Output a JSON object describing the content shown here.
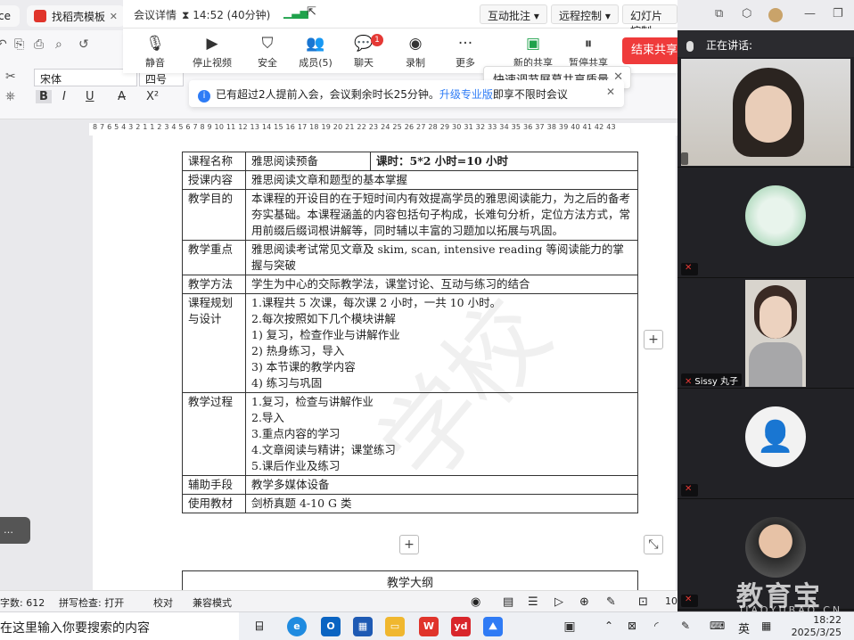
{
  "browser_tabs": [
    {
      "label": "ce"
    },
    {
      "label": "找稻壳模板"
    }
  ],
  "meeting": {
    "details_label": "会议详情",
    "time": "14:52 (40分钟)",
    "annotate_label": "互动批注",
    "remote_label": "远程控制",
    "slideshow_label": "幻灯片控制",
    "toolbar": [
      {
        "label": "静音",
        "icon": "mic-icon"
      },
      {
        "label": "停止视频",
        "icon": "camera-icon"
      },
      {
        "label": "安全",
        "icon": "shield-icon"
      },
      {
        "label": "成员(5)",
        "icon": "members-icon"
      },
      {
        "label": "聊天",
        "icon": "chat-icon",
        "badge": "1"
      },
      {
        "label": "录制",
        "icon": "record-icon"
      },
      {
        "label": "更多",
        "icon": "more-icon"
      },
      {
        "label": "新的共享",
        "icon": "share-icon"
      },
      {
        "label": "暂停共享",
        "icon": "pause-icon"
      }
    ],
    "end_share_label": "结束共享",
    "quality_tip": "快速调节屏幕共享质量",
    "notice_text": "已有超过2人提前入会，会议剩余时长25分钟。",
    "notice_link": "升级专业版",
    "notice_tail": "即享不限时会议",
    "speaking_label": "正在讲话:"
  },
  "editor": {
    "font_name": "宋体",
    "font_size": "四号",
    "ruler_text": "8 7 6 5 4 3 2 1   1 2 3 4 5 6 7 8 9 10 11 12 13 14 15 16 17 18 19 20 21 22 23 24 25 26 27 28 29 30 31 32 33 34 35 36 37 38 39 40 41 42 43"
  },
  "document": {
    "rows": [
      {
        "head": "课程名称",
        "value": "雅思阅读预备",
        "extra": "课时：5*2 小时=10 小时"
      },
      {
        "head": "授课内容",
        "value": "雅思阅读文章和题型的基本掌握"
      },
      {
        "head": "教学目的",
        "value": "本课程的开设目的在于短时间内有效提高学员的雅思阅读能力，为之后的备考夯实基础。本课程涵盖的内容包括句子构成，长难句分析，定位方法方式，常用前缀后缀词根讲解等，同时辅以丰富的习题加以拓展与巩固。"
      },
      {
        "head": "教学重点",
        "value": "雅思阅读考试常见文章及 skim, scan, intensive reading 等阅读能力的掌握与突破"
      },
      {
        "head": "教学方法",
        "value": "学生为中心的交际教学法，课堂讨论、互动与练习的结合"
      },
      {
        "head": "课程规划与设计",
        "lines": [
          "1.课程共 5 次课，每次课 2 小时，一共 10 小时。",
          "2.每次按照如下几个模块讲解",
          "1)  复习，检查作业与讲解作业",
          "2)  热身练习，导入",
          "3)  本节课的教学内容",
          "4)  练习与巩固"
        ]
      },
      {
        "head": "教学过程",
        "lines": [
          "1.复习，检查与讲解作业",
          "2.导入",
          "3.重点内容的学习",
          "4.文章阅读与精讲；课堂练习",
          "5.课后作业及练习"
        ]
      },
      {
        "head": "辅助手段",
        "value": "教学多媒体设备"
      },
      {
        "head": "使用教材",
        "value": "剑桥真题 4-10 G 类"
      }
    ],
    "outline_title": "教学大纲",
    "watermark": "学校"
  },
  "status_bar": {
    "word_count": "字数: 612",
    "spell_check": "拼写检查: 打开",
    "proofread": "校对",
    "compat": "兼容模式",
    "zoom": "10"
  },
  "participants": [
    {
      "name": "",
      "kind": "camera"
    },
    {
      "name": "",
      "kind": "avatar"
    },
    {
      "name": "Sissy 丸子",
      "kind": "camera"
    },
    {
      "name": "",
      "kind": "placeholder"
    },
    {
      "name": "",
      "kind": "avatar"
    }
  ],
  "taskbar": {
    "search_placeholder": "在这里输入你要搜索的内容",
    "ime": "英",
    "time": "18:22",
    "date": "2025/3/25"
  },
  "watermark_brand": {
    "name": "教育宝",
    "sub": "JIAOYUBAO.CN"
  },
  "colors": {
    "accent": "#2e7cf6",
    "end_button": "#ef3b3b",
    "badge": "#e53935"
  }
}
